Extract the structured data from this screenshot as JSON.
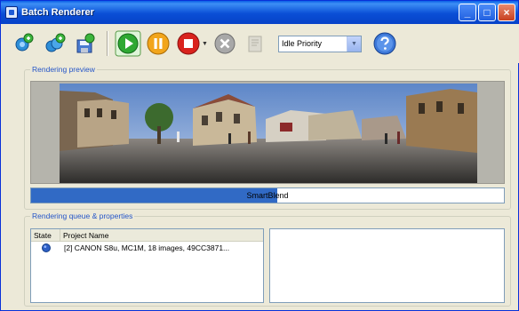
{
  "window": {
    "title": "Batch Renderer"
  },
  "title_buttons": {
    "minimize": "_",
    "maximize": "□",
    "close": "×"
  },
  "toolbar": {
    "buttons": [
      {
        "name": "add-project-icon"
      },
      {
        "name": "add-projects-icon"
      },
      {
        "name": "save-queue-icon"
      },
      {
        "name": "start-render-icon"
      },
      {
        "name": "pause-render-icon"
      },
      {
        "name": "stop-render-icon"
      },
      {
        "name": "remove-project-icon"
      },
      {
        "name": "settings-icon"
      }
    ],
    "priority": {
      "value": "Idle Priority"
    },
    "help_icon": "help-icon"
  },
  "preview": {
    "label": "Rendering preview",
    "progress_text": "SmartBlend",
    "progress": 0.52
  },
  "queue": {
    "label": "Rendering queue & properties",
    "columns": [
      "State",
      "Project Name"
    ],
    "rows": [
      {
        "state_icon": "pending-state-icon",
        "name": "[2] CANON S8u, MC1M, 18 images, 49CC3871..."
      }
    ]
  },
  "colors": {
    "accent": "#316ac5",
    "titlebar": "#0a4fd6",
    "group_label": "#2455c8"
  }
}
